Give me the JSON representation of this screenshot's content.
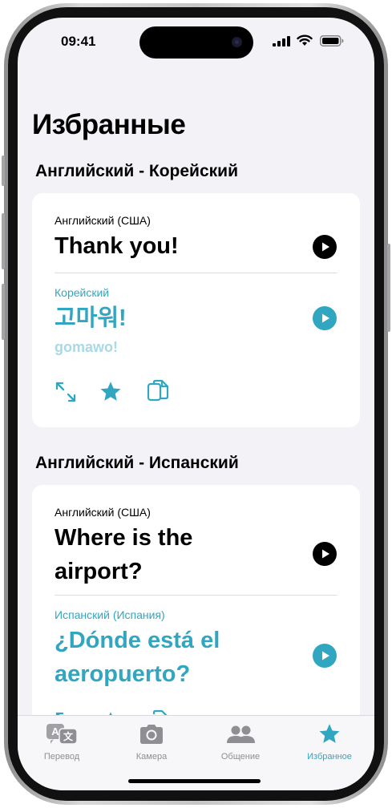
{
  "status": {
    "time": "09:41"
  },
  "page": {
    "title": "Избранные"
  },
  "groups": [
    {
      "heading": "Английский - Корейский",
      "source_lang": "Английский (США)",
      "source_text": "Thank you!",
      "target_lang": "Корейский",
      "target_text": "고마워!",
      "transliteration": "gomawo!"
    },
    {
      "heading": "Английский - Испанский",
      "source_lang": "Английский (США)",
      "source_line1": "Where is the",
      "source_line2": "airport?",
      "target_lang": "Испанский (Испания)",
      "target_line1": "¿Dónde está el",
      "target_line2": "aeropuerto?"
    }
  ],
  "icons": {
    "play": "play-icon",
    "expand": "expand-arrows-icon",
    "favorite": "star-icon",
    "copy": "copy-icon"
  },
  "tabbar": {
    "active": "favorites",
    "tabs": [
      {
        "id": "translate",
        "label": "Перевод",
        "icon": "translate-icon"
      },
      {
        "id": "camera",
        "label": "Камера",
        "icon": "camera-icon"
      },
      {
        "id": "conversation",
        "label": "Общение",
        "icon": "people-icon"
      },
      {
        "id": "favorites",
        "label": "Избранное",
        "icon": "star-icon"
      }
    ]
  },
  "colors": {
    "accent": "#31a6c1",
    "inactive": "#8e8e93",
    "background": "#f2f2f7"
  }
}
